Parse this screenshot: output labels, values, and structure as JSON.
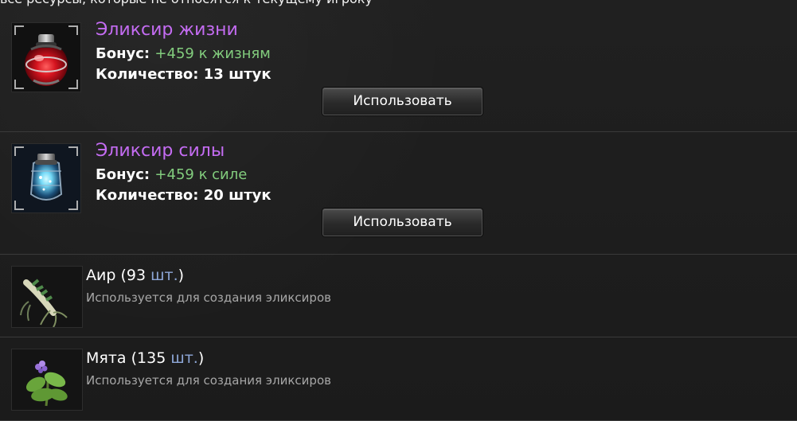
{
  "top_text": "все ресурсы, которые не относятся к текущему игроку",
  "elixirs": [
    {
      "name": "Эликсир жизни",
      "bonus_label": "Бонус:",
      "bonus_value": "+459 к жизням",
      "qty_label": "Количество:",
      "qty_value": "13",
      "qty_unit": "штук",
      "button_label": "Использовать",
      "icon_name": "red-potion-icon"
    },
    {
      "name": "Эликсир силы",
      "bonus_label": "Бонус:",
      "bonus_value": "+459 к силе",
      "qty_label": "Количество:",
      "qty_value": "20",
      "qty_unit": "штук",
      "button_label": "Использовать",
      "icon_name": "blue-potion-icon"
    }
  ],
  "resources": [
    {
      "name": "Аир",
      "count": "93",
      "unit": "шт.",
      "description": "Используется для создания эликсиров",
      "icon_name": "root-herb-icon"
    },
    {
      "name": "Мята",
      "count": "135",
      "unit": "шт.",
      "description": "Используется для создания эликсиров",
      "icon_name": "mint-herb-icon"
    }
  ],
  "colors": {
    "background": "#1e1e1e",
    "elixir_name": "#c46cf2",
    "bonus_value": "#82cc7d",
    "resource_unit": "#8ea7d8",
    "description": "#a7a7a7"
  }
}
